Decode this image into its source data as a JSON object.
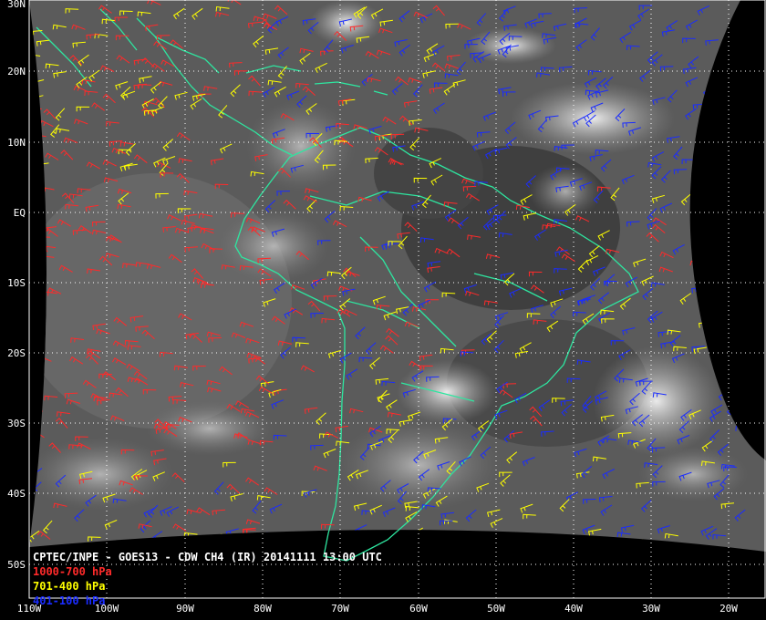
{
  "title": "CPTEC/INPE - GOES13 - CDW CH4 (IR) 20141111 13:00 UTC",
  "legend": [
    {
      "label": "1000-700 hPa",
      "color": "#ff2a2a"
    },
    {
      "label": "701-400 hPa",
      "color": "#ffff00"
    },
    {
      "label": "401-100 hPa",
      "color": "#1a2cff"
    }
  ],
  "lat_labels": [
    "30N",
    "20N",
    "10N",
    "EQ",
    "10S",
    "20S",
    "30S",
    "40S",
    "50S"
  ],
  "lon_labels": [
    "110W",
    "100W",
    "90W",
    "80W",
    "70W",
    "60W",
    "50W",
    "40W",
    "30W",
    "20W"
  ],
  "colors": {
    "coastline": "#2ee6a0",
    "grid": "#ffffff",
    "background": "#000000"
  }
}
